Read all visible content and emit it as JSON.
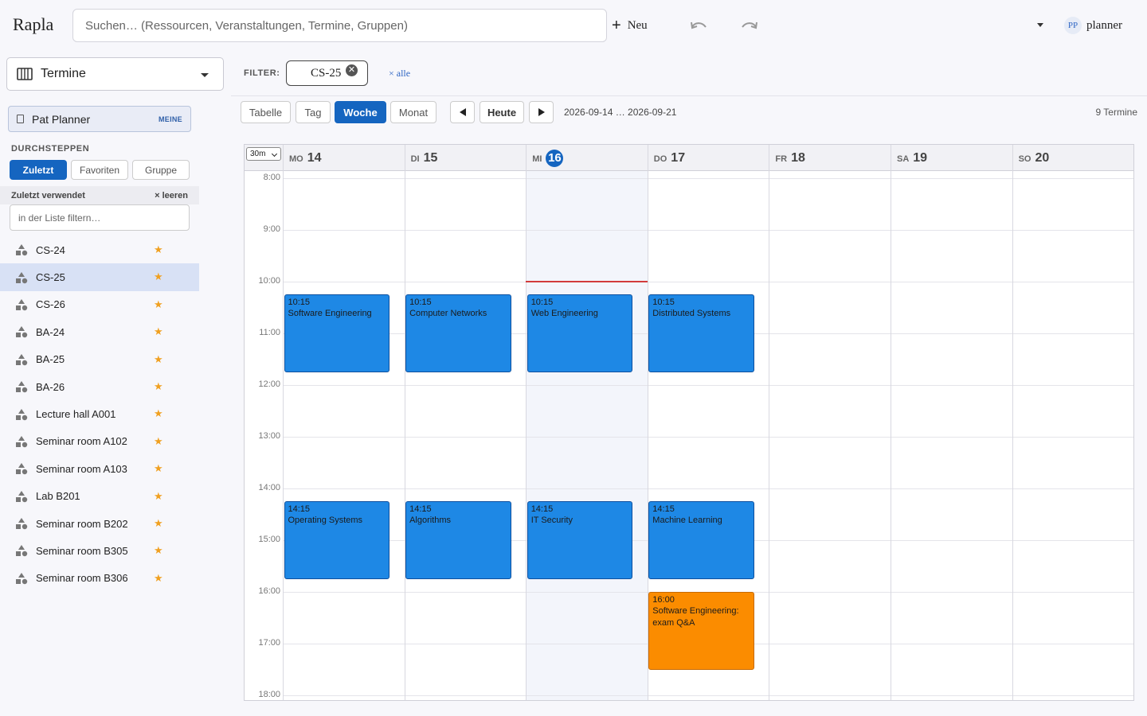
{
  "app": {
    "title": "Rapla"
  },
  "search": {
    "placeholder": "Suchen… (Ressourcen, Veranstaltungen, Termine, Gruppen)"
  },
  "toolbar_top": {
    "new_label": "Neu",
    "user_initials": "PP",
    "user_name": "planner"
  },
  "sidebar": {
    "view_label": "Termine",
    "me_name": "Pat Planner",
    "me_badge": "MEINE",
    "browse_title": "DURCHSTEPPEN",
    "tabs": [
      "Zuletzt",
      "Favoriten",
      "Gruppe"
    ],
    "recent_label": "Zuletzt verwendet",
    "clear_label": "× leeren",
    "filter_placeholder": "in der Liste filtern…",
    "items": [
      {
        "label": "CS-24",
        "selected": false
      },
      {
        "label": "CS-25",
        "selected": true
      },
      {
        "label": "CS-26",
        "selected": false
      },
      {
        "label": "BA-24",
        "selected": false
      },
      {
        "label": "BA-25",
        "selected": false
      },
      {
        "label": "BA-26",
        "selected": false
      },
      {
        "label": "Lecture hall A001",
        "selected": false
      },
      {
        "label": "Seminar room A102",
        "selected": false
      },
      {
        "label": "Seminar room A103",
        "selected": false
      },
      {
        "label": "Lab B201",
        "selected": false
      },
      {
        "label": "Seminar room B202",
        "selected": false
      },
      {
        "label": "Seminar room B305",
        "selected": false
      },
      {
        "label": "Seminar room B306",
        "selected": false
      }
    ]
  },
  "filter": {
    "label": "FILTER:",
    "chip": "CS-25",
    "clear_all": "× alle"
  },
  "view_toolbar": {
    "tabs": [
      "Tabelle",
      "Tag",
      "Woche",
      "Monat"
    ],
    "active_tab": "Woche",
    "today_label": "Heute",
    "date_range": "2026-09-14 … 2026-09-21",
    "count": "9 Termine"
  },
  "calendar": {
    "zoom": "30m",
    "days": [
      {
        "name": "MO",
        "num": "14",
        "today": false
      },
      {
        "name": "DI",
        "num": "15",
        "today": false
      },
      {
        "name": "MI",
        "num": "16",
        "today": true
      },
      {
        "name": "DO",
        "num": "17",
        "today": false
      },
      {
        "name": "FR",
        "num": "18",
        "today": false
      },
      {
        "name": "SA",
        "num": "19",
        "today": false
      },
      {
        "name": "SO",
        "num": "20",
        "today": false
      }
    ],
    "hours": [
      "8:00",
      "9:00",
      "10:00",
      "11:00",
      "12:00",
      "13:00",
      "14:00",
      "15:00",
      "16:00",
      "17:00",
      "18:00"
    ],
    "now_line": {
      "day": 2,
      "time": "10:00"
    },
    "events": [
      {
        "day": 0,
        "start": "10:15",
        "end": "11:45",
        "title": "Software Engineering",
        "color": "#1e88e5"
      },
      {
        "day": 1,
        "start": "10:15",
        "end": "11:45",
        "title": "Computer Networks",
        "color": "#1e88e5"
      },
      {
        "day": 2,
        "start": "10:15",
        "end": "11:45",
        "title": "Web Engineering",
        "color": "#1e88e5"
      },
      {
        "day": 3,
        "start": "10:15",
        "end": "11:45",
        "title": "Distributed Systems",
        "color": "#1e88e5"
      },
      {
        "day": 0,
        "start": "14:15",
        "end": "15:45",
        "title": "Operating Systems",
        "color": "#1e88e5"
      },
      {
        "day": 1,
        "start": "14:15",
        "end": "15:45",
        "title": "Algorithms",
        "color": "#1e88e5"
      },
      {
        "day": 2,
        "start": "14:15",
        "end": "15:45",
        "title": "IT Security",
        "color": "#1e88e5"
      },
      {
        "day": 3,
        "start": "14:15",
        "end": "15:45",
        "title": "Machine Learning",
        "color": "#1e88e5"
      },
      {
        "day": 3,
        "start": "16:00",
        "end": "17:30",
        "title": "Software Engineering: exam Q&A",
        "color": "#fb8c00"
      }
    ]
  }
}
